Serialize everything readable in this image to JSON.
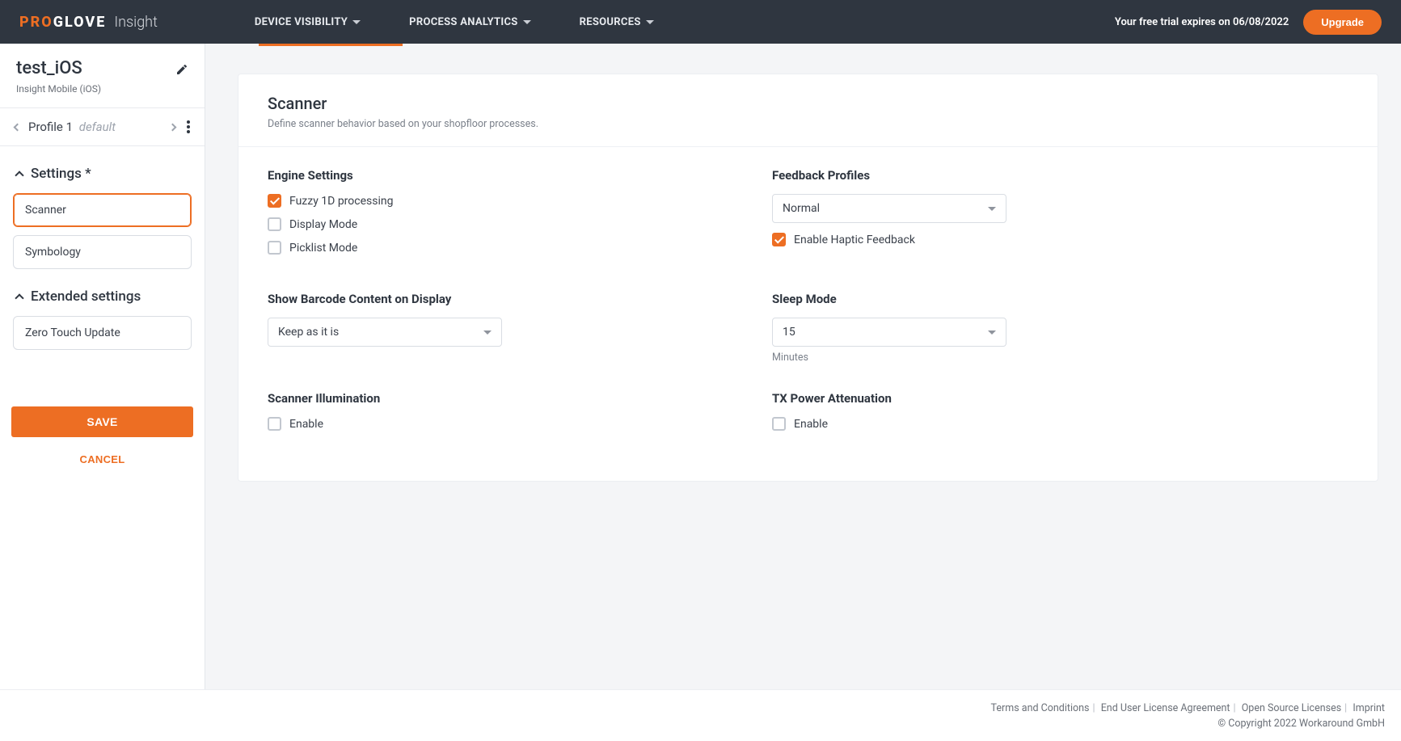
{
  "header": {
    "brand_accent": "PRO",
    "brand_rest": "GLOVE",
    "brand_sub": "Insight",
    "nav": [
      {
        "label": "DEVICE VISIBILITY"
      },
      {
        "label": "PROCESS ANALYTICS"
      },
      {
        "label": "RESOURCES"
      }
    ],
    "trial_text": "Your free trial expires on 06/08/2022",
    "upgrade_label": "Upgrade"
  },
  "sidebar": {
    "title": "test_iOS",
    "subtitle": "Insight Mobile (iOS)",
    "profile_label": "Profile 1",
    "profile_default": "default",
    "sections": {
      "settings_heading": "Settings *",
      "settings_items": [
        "Scanner",
        "Symbology"
      ],
      "extended_heading": "Extended settings",
      "extended_items": [
        "Zero Touch Update"
      ]
    },
    "save_label": "SAVE",
    "cancel_label": "CANCEL"
  },
  "panel": {
    "title": "Scanner",
    "description": "Define scanner behavior based on your shopfloor processes.",
    "left": {
      "engine_heading": "Engine Settings",
      "engine_options": [
        {
          "label": "Fuzzy 1D processing",
          "checked": true
        },
        {
          "label": "Display Mode",
          "checked": false
        },
        {
          "label": "Picklist Mode",
          "checked": false
        }
      ],
      "barcode_heading": "Show Barcode Content on Display",
      "barcode_select": "Keep as it is",
      "illum_heading": "Scanner Illumination",
      "illum_option": {
        "label": "Enable",
        "checked": false
      }
    },
    "right": {
      "feedback_heading": "Feedback Profiles",
      "feedback_select": "Normal",
      "feedback_option": {
        "label": "Enable Haptic Feedback",
        "checked": true
      },
      "sleep_heading": "Sleep Mode",
      "sleep_select": "15",
      "sleep_unit": "Minutes",
      "tx_heading": "TX Power Attenuation",
      "tx_option": {
        "label": "Enable",
        "checked": false
      }
    }
  },
  "footer": {
    "links": [
      "Terms and Conditions",
      "End User License Agreement",
      "Open Source Licenses",
      "Imprint"
    ],
    "copyright": "© Copyright 2022 Workaround GmbH"
  }
}
